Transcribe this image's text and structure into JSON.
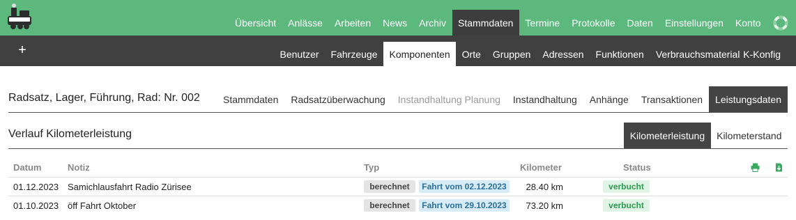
{
  "colors": {
    "brand_green": "#5cb87c",
    "nav_dark": "#404040",
    "active_tab": "#444444",
    "status_green": "#2e9a50",
    "link_blue": "#2a6f9a"
  },
  "topnav": {
    "items": [
      "Übersicht",
      "Anlässe",
      "Arbeiten",
      "News",
      "Archiv",
      "Stammdaten",
      "Termine",
      "Protokolle",
      "Daten",
      "Einstellungen",
      "Konto"
    ],
    "active": "Stammdaten",
    "logo_icon": "locomotive-logo-icon",
    "help_icon": "lifebuoy-icon"
  },
  "subnav": {
    "add_icon": "plus-icon",
    "add_label": "+",
    "items": [
      "Benutzer",
      "Fahrzeuge",
      "Komponenten",
      "Orte",
      "Gruppen",
      "Adressen",
      "Funktionen",
      "Verbrauchsmaterial"
    ],
    "active": "Komponenten",
    "right_item": "K-Konfig"
  },
  "record": {
    "title": "Radsatz, Lager, Führung, Rad: Nr. 002",
    "tabs": [
      {
        "label": "Stammdaten",
        "state": "normal"
      },
      {
        "label": "Radsatzüberwachung",
        "state": "normal"
      },
      {
        "label": "Instandhaltung Planung",
        "state": "muted"
      },
      {
        "label": "Instandhaltung",
        "state": "normal"
      },
      {
        "label": "Anhänge",
        "state": "normal"
      },
      {
        "label": "Transaktionen",
        "state": "normal"
      },
      {
        "label": "Leistungsdaten",
        "state": "active"
      }
    ]
  },
  "section": {
    "title": "Verlauf Kilometerleistung",
    "tabs": [
      {
        "label": "Kilometerleistung",
        "state": "active"
      },
      {
        "label": "Kilometerstand",
        "state": "normal"
      }
    ]
  },
  "table": {
    "columns": {
      "datum": "Datum",
      "notiz": "Notiz",
      "typ": "Typ",
      "kilometer": "Kilometer",
      "status": "Status"
    },
    "actions": [
      "print-icon",
      "download-icon"
    ],
    "rows": [
      {
        "datum": "01.12.2023",
        "notiz": "Samichlausfahrt Radio Zürisee",
        "typ": "berechnet",
        "trip": "Fahrt vom 02.12.2023",
        "kilometer": "28.40 km",
        "status": "verbucht"
      },
      {
        "datum": "01.10.2023",
        "notiz": "öff Fahrt Oktober",
        "typ": "berechnet",
        "trip": "Fahrt vom 29.10.2023",
        "kilometer": "73.20 km",
        "status": "verbucht"
      }
    ]
  }
}
